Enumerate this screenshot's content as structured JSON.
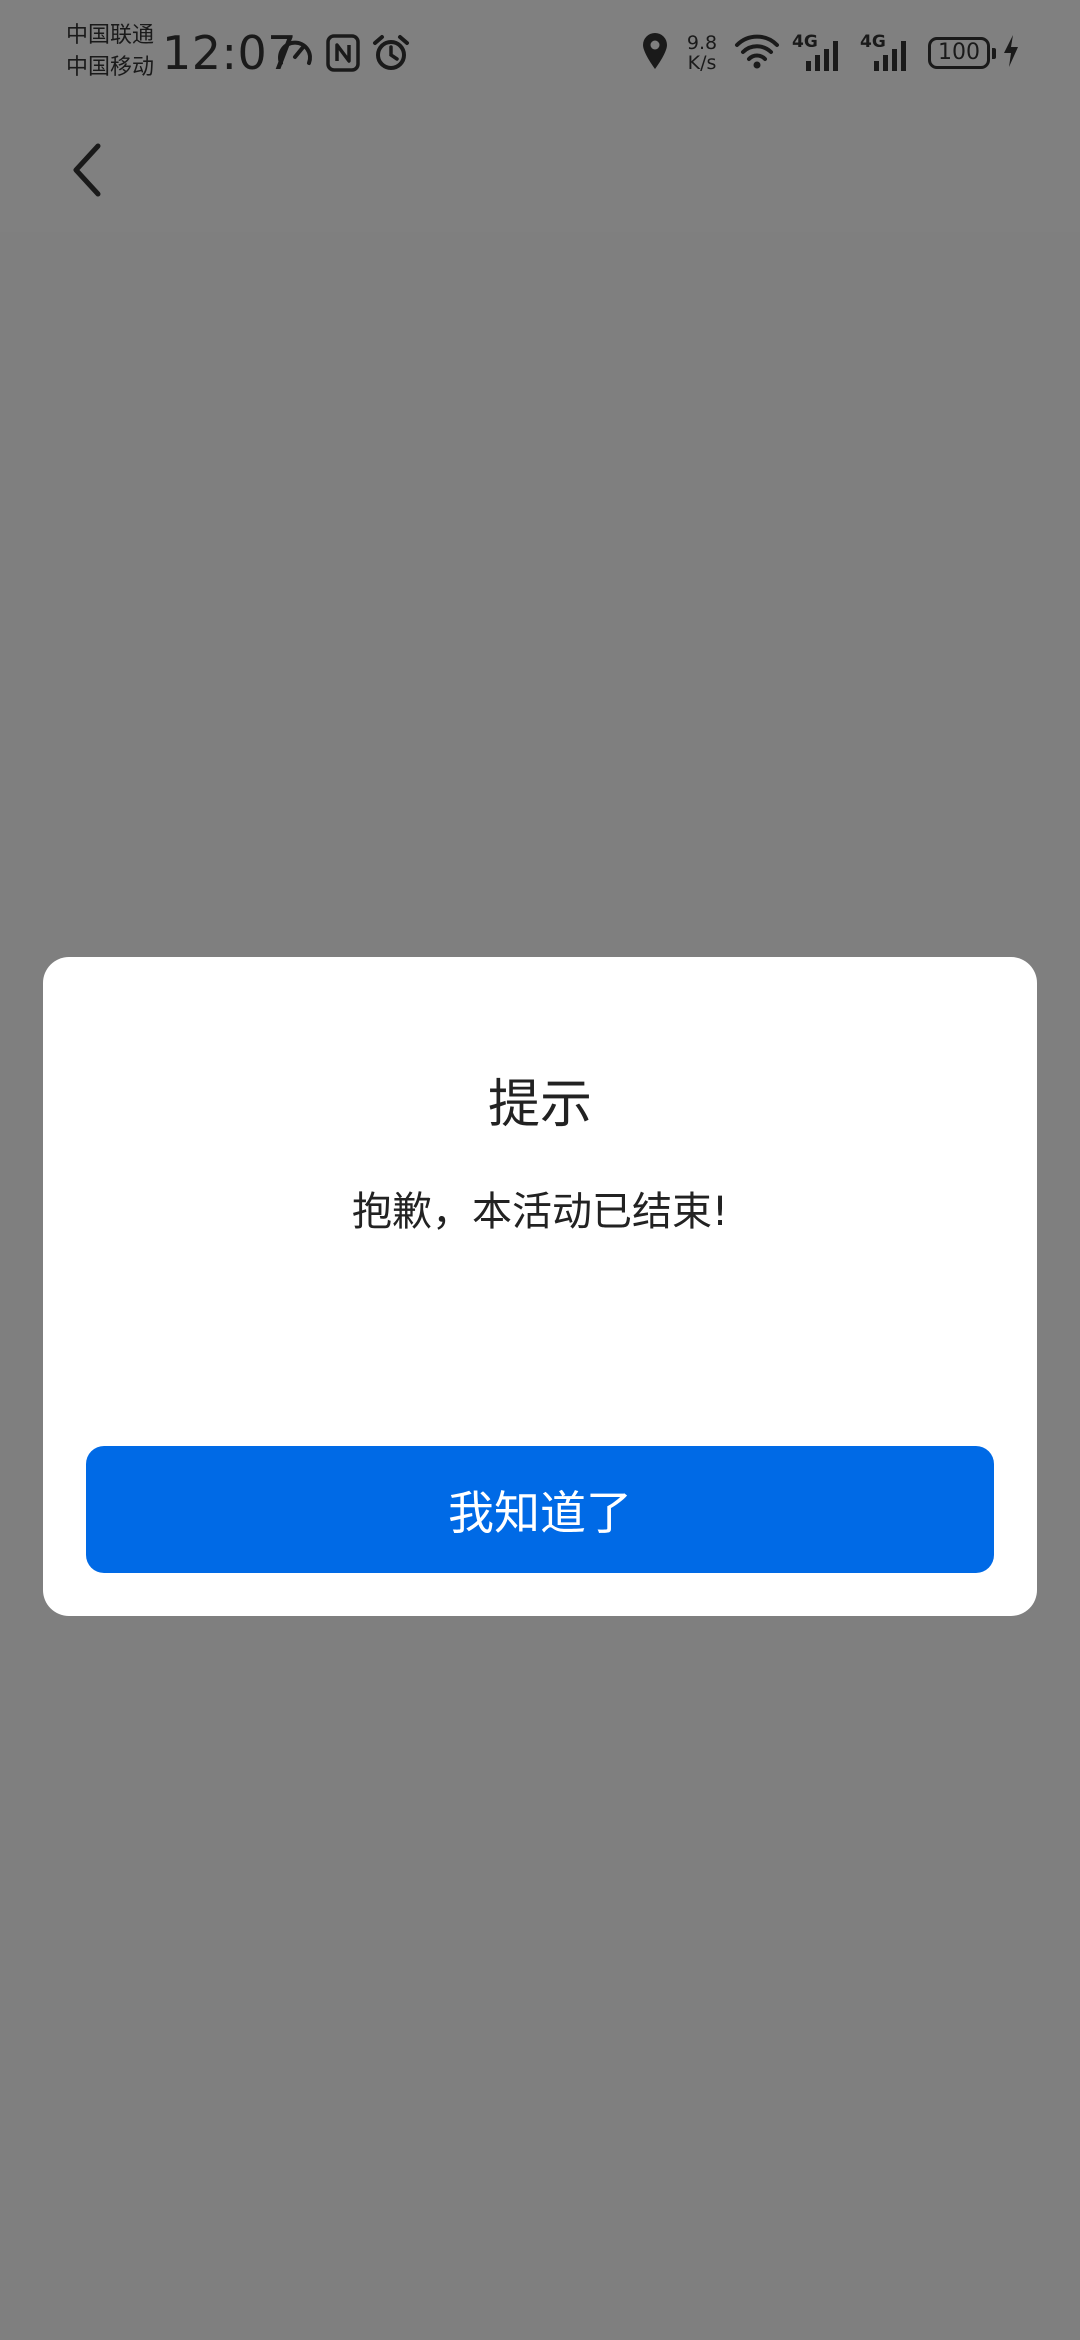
{
  "status_bar": {
    "carrier_1": "中国联通",
    "carrier_2": "中国移动",
    "time": "12:07",
    "net_speed_value": "9.8",
    "net_speed_unit": "K/s",
    "signal_1_label": "4G",
    "signal_2_label": "4G",
    "battery_level": "100",
    "icons": [
      "speedometer-icon",
      "nfc-icon",
      "alarm-icon",
      "location-icon",
      "wifi-icon",
      "signal-icon",
      "battery-icon",
      "charging-icon"
    ]
  },
  "nav": {
    "back_icon": "chevron-left-icon"
  },
  "dialog": {
    "title": "提示",
    "message": "抱歉，本活动已结束!",
    "confirm_label": "我知道了"
  },
  "colors": {
    "overlay": "#7f7f7f",
    "primary": "#006ae6",
    "dialog_bg": "#ffffff",
    "text": "#222222"
  }
}
